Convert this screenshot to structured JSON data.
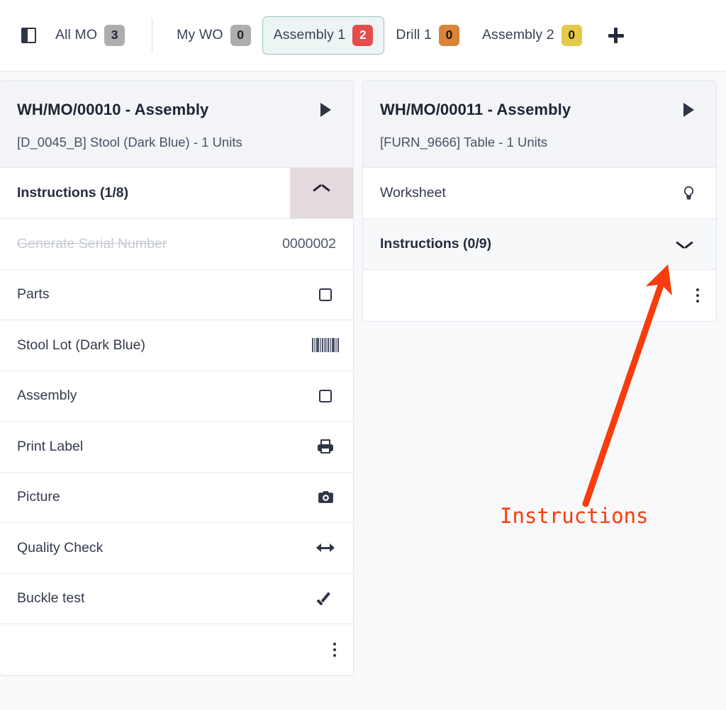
{
  "topbar": {
    "sidebar_toggle_icon": "panel-toggle-icon",
    "add_tab_icon": "plus-icon",
    "tabs": [
      {
        "label": "All MO",
        "count": "3",
        "color": "#adadad",
        "style": "gray",
        "active": false
      },
      {
        "label": "My WO",
        "count": "0",
        "color": "#adadad",
        "style": "gray",
        "active": false
      },
      {
        "label": "Assembly 1",
        "count": "2",
        "color": "#e54b4b",
        "style": "red",
        "active": true
      },
      {
        "label": "Drill 1",
        "count": "0",
        "color": "#d98438",
        "style": "orange",
        "active": false
      },
      {
        "label": "Assembly 2",
        "count": "0",
        "color": "#e6c94a",
        "style": "yellow",
        "active": false
      }
    ]
  },
  "cards": [
    {
      "title": "WH/MO/00010 - Assembly",
      "subtitle": "[D_0045_B] Stool (Dark Blue) - 1 Units",
      "play_icon": "play-icon",
      "section": {
        "label": "Instructions (1/8)",
        "expanded": true,
        "chevron_icon": "chevron-up-icon"
      },
      "steps": [
        {
          "label": "Generate Serial Number",
          "value": "0000002",
          "icon": "",
          "done": true
        },
        {
          "label": "Parts",
          "value": "",
          "icon": "checkbox-icon",
          "done": false
        },
        {
          "label": "Stool Lot (Dark Blue)",
          "value": "",
          "icon": "barcode-icon",
          "done": false
        },
        {
          "label": "Assembly",
          "value": "",
          "icon": "checkbox-icon",
          "done": false
        },
        {
          "label": "Print Label",
          "value": "",
          "icon": "printer-icon",
          "done": false
        },
        {
          "label": "Picture",
          "value": "",
          "icon": "camera-icon",
          "done": false
        },
        {
          "label": "Quality Check",
          "value": "",
          "icon": "arrows-horizontal-icon",
          "done": false
        },
        {
          "label": "Buckle test",
          "value": "",
          "icon": "check-icon",
          "done": false
        }
      ],
      "footer_icon": "kebab-menu-icon"
    },
    {
      "title": "WH/MO/00011 - Assembly",
      "subtitle": "[FURN_9666] Table - 1 Units",
      "play_icon": "play-icon",
      "worksheet": {
        "label": "Worksheet",
        "icon": "lightbulb-icon"
      },
      "section": {
        "label": "Instructions (0/9)",
        "expanded": false,
        "chevron_icon": "chevron-down-icon"
      },
      "footer_icon": "kebab-menu-icon"
    }
  ],
  "annotation": {
    "text": "Instructions",
    "color": "#f93c0c",
    "arrow_icon": "annotation-arrow-icon"
  }
}
